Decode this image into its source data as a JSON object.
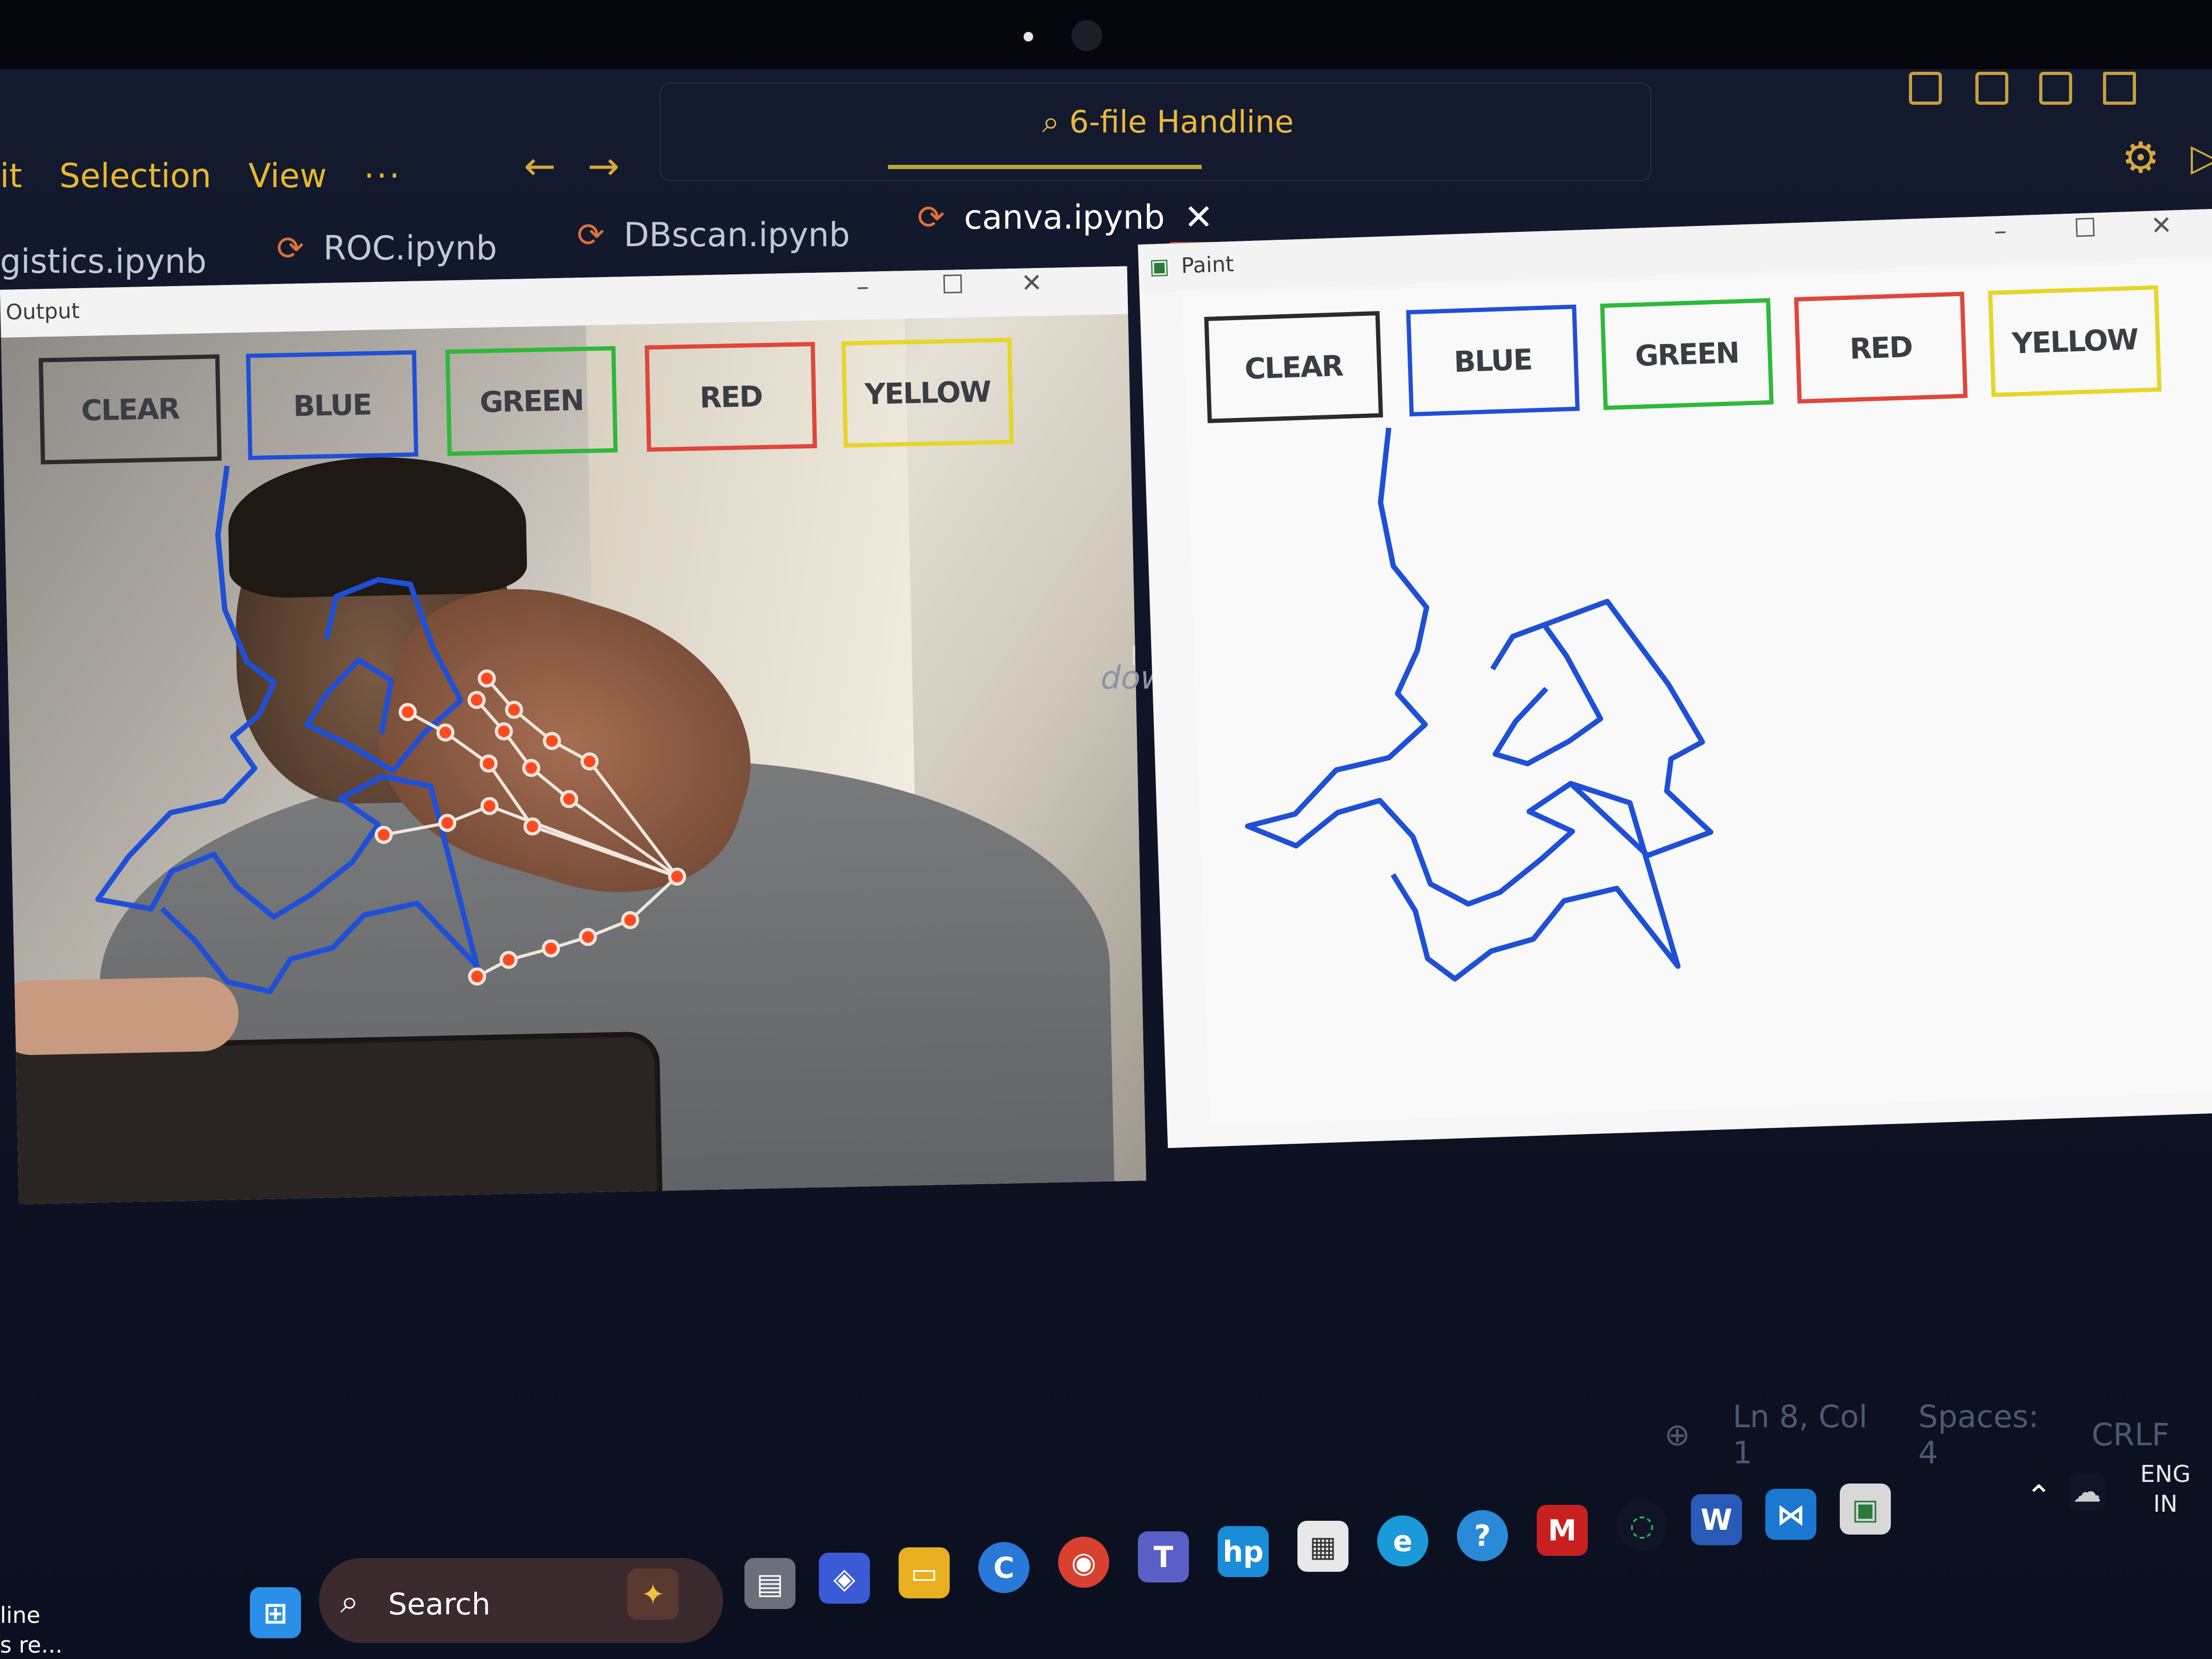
{
  "menu": {
    "items": [
      "it",
      "Selection",
      "View",
      "···"
    ]
  },
  "command_center": {
    "label": "6-file Handline"
  },
  "tabs": [
    {
      "label": "gistics.ipynb"
    },
    {
      "label": "ROC.ipynb"
    },
    {
      "label": "DBscan.ipynb"
    },
    {
      "label": "canva.ipynb",
      "active": true
    }
  ],
  "output_window": {
    "title": "Output",
    "buttons": [
      {
        "label": "CLEAR",
        "color": "#2b2b2b"
      },
      {
        "label": "BLUE",
        "color": "#1f4fd6"
      },
      {
        "label": "GREEN",
        "color": "#2fb83a"
      },
      {
        "label": "RED",
        "color": "#e0463a"
      },
      {
        "label": "YELLOW",
        "color": "#e6d62a"
      }
    ]
  },
  "paint_window": {
    "title": "Paint",
    "buttons": [
      {
        "label": "CLEAR",
        "color": "#2b2b2b"
      },
      {
        "label": "BLUE",
        "color": "#1f4fd6"
      },
      {
        "label": "GREEN",
        "color": "#2fb83a"
      },
      {
        "label": "RED",
        "color": "#e0463a"
      },
      {
        "label": "YELLOW",
        "color": "#e6d62a"
      }
    ]
  },
  "editor_fragment": "dows",
  "status_bar": {
    "cursor_position": "Ln 8, Col 1",
    "spaces": "Spaces: 4",
    "eol": "CRLF"
  },
  "taskbar": {
    "search_label": "Search",
    "language": "ENG",
    "region": "IN",
    "left_text_1": "line",
    "left_text_2": "s re..."
  },
  "icons": {
    "window_controls": [
      "minimize-icon",
      "maximize-icon",
      "close-icon"
    ],
    "brush_color": "#1f4fd6",
    "landmark_color": "#ff4a1f"
  }
}
